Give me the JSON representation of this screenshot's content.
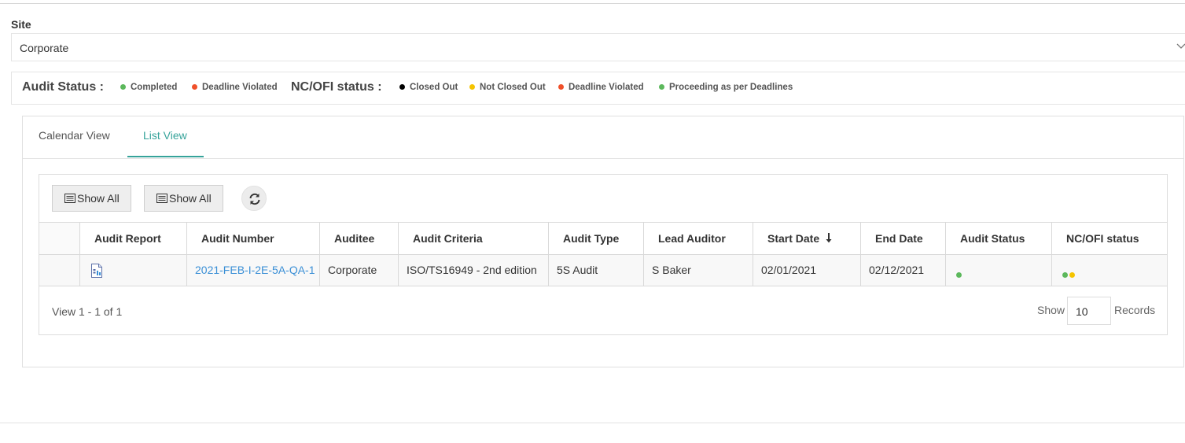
{
  "site": {
    "label": "Site",
    "value": "Corporate"
  },
  "legend": {
    "audit_heading": "Audit Status :",
    "audit_items": [
      {
        "label": "Completed",
        "color": "#5cb85c"
      },
      {
        "label": "Deadline Violated",
        "color": "#f0502a"
      }
    ],
    "nc_heading": "NC/OFI status :",
    "nc_items": [
      {
        "label": "Closed Out",
        "color": "#000000"
      },
      {
        "label": "Not Closed Out",
        "color": "#f5c400"
      },
      {
        "label": "Deadline Violated",
        "color": "#f0502a"
      },
      {
        "label": "Proceeding as per Deadlines",
        "color": "#5cb85c"
      }
    ]
  },
  "tabs": [
    {
      "label": "Calendar View",
      "active": false
    },
    {
      "label": "List View",
      "active": true
    }
  ],
  "toolbar": {
    "show_all_1": "Show All",
    "show_all_2": "Show All",
    "refresh_icon": "refresh-icon"
  },
  "table": {
    "columns": [
      "",
      "Audit Report",
      "Audit Number",
      "Auditee",
      "Audit Criteria",
      "Audit Type",
      "Lead Auditor",
      "Start Date",
      "End Date",
      "Audit Status",
      "NC/OFI status"
    ],
    "sorted_column": "Start Date",
    "sort_direction": "descending",
    "rows": [
      {
        "audit_report_icon": "document-icon",
        "audit_number": "2021-FEB-I-2E-5A-QA-1",
        "auditee": "Corporate",
        "audit_criteria": "ISO/TS16949 - 2nd edition",
        "audit_type": "5S Audit",
        "lead_auditor": "S Baker",
        "start_date": "02/01/2021",
        "end_date": "02/12/2021",
        "audit_status_colors": [
          "#5cb85c"
        ],
        "nc_status_colors": [
          "#5cb85c",
          "#f5c400"
        ]
      }
    ]
  },
  "pager": {
    "view_text": "View 1 - 1 of 1",
    "show_label": "Show",
    "records_value": "10",
    "records_label": "Records"
  },
  "colors": {
    "accent": "#36a39a",
    "link": "#3a8fd6"
  }
}
